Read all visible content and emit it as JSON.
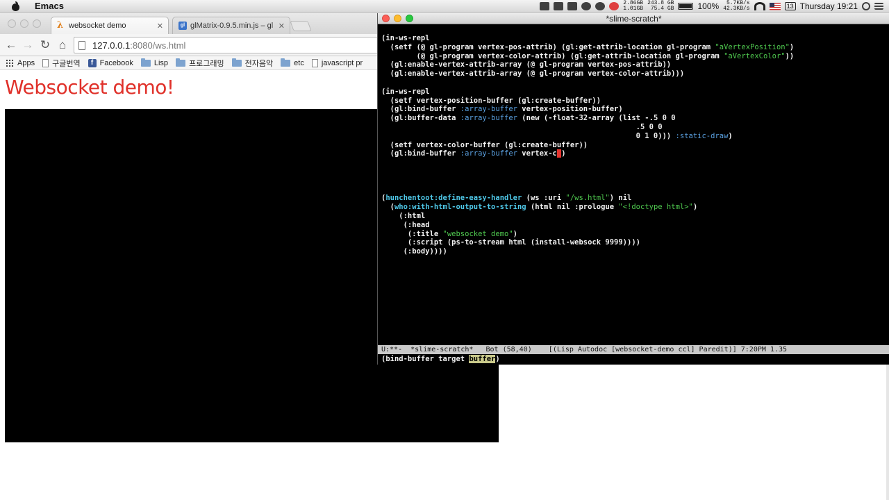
{
  "menubar": {
    "app_name": "Emacs",
    "mem_used": "2.86GB",
    "mem_free": "1.01GB",
    "disk_used": "243.8 GB",
    "disk_free": "75.4 GB",
    "battery": "100%",
    "net_up": "5.7KB/s",
    "net_down": "42.3KB/s",
    "calendar_day": "13",
    "clock": "Thursday 19:21"
  },
  "browser": {
    "tabs": [
      {
        "label": "websocket demo",
        "active": true
      },
      {
        "label": "glMatrix-0.9.5.min.js – gl",
        "active": false
      }
    ],
    "url_host": "127.0.0.1",
    "url_rest": ":8080/ws.html",
    "bookmarks": [
      "Apps",
      "구글번역",
      "Facebook",
      "Lisp",
      "프로그래밍",
      "전자음악",
      "etc",
      "javascript pr"
    ],
    "page_heading": "Websocket demo!"
  },
  "emacs": {
    "title": "*slime-scratch*",
    "code_lines": [
      [
        {
          "t": "(in-ws-repl"
        }
      ],
      [
        {
          "t": "  (setf (@ gl-program vertex-pos-attrib) (gl:get-attrib-location gl-program "
        },
        {
          "t": "\"aVertexPosition\"",
          "c": "str"
        },
        {
          "t": ")"
        }
      ],
      [
        {
          "t": "        (@ gl-program vertex-color-attrib) (gl:get-attrib-location gl-program "
        },
        {
          "t": "\"aVertexColor\"",
          "c": "str"
        },
        {
          "t": "))"
        }
      ],
      [
        {
          "t": "  (gl:enable-vertex-attrib-array (@ gl-program vertex-pos-attrib))"
        }
      ],
      [
        {
          "t": "  (gl:enable-vertex-attrib-array (@ gl-program vertex-color-attrib)))"
        }
      ],
      [
        {
          "t": ""
        }
      ],
      [
        {
          "t": "(in-ws-repl"
        }
      ],
      [
        {
          "t": "  (setf vertex-position-buffer (gl:create-buffer))"
        }
      ],
      [
        {
          "t": "  (gl:bind-buffer "
        },
        {
          "t": ":array-buffer",
          "c": "kw"
        },
        {
          "t": " vertex-position-buffer)"
        }
      ],
      [
        {
          "t": "  (gl:buffer-data "
        },
        {
          "t": ":array-buffer",
          "c": "kw"
        },
        {
          "t": " (new (-float-32-array (list -.5 0 0"
        }
      ],
      [
        {
          "t": "                                                          .5 0 0"
        }
      ],
      [
        {
          "t": "                                                          0 1 0))) "
        },
        {
          "t": ":static-draw",
          "c": "kw"
        },
        {
          "t": ")"
        }
      ],
      [
        {
          "t": "  (setf vertex-color-buffer (gl:create-buffer))"
        }
      ],
      [
        {
          "t": "  (gl:bind-buffer "
        },
        {
          "t": ":array-buffer",
          "c": "kw"
        },
        {
          "t": " vertex-c"
        },
        {
          "t": ")",
          "c": "cursor"
        },
        {
          "t": ")"
        }
      ],
      [
        {
          "t": ""
        }
      ],
      [
        {
          "t": ""
        }
      ],
      [
        {
          "t": ""
        }
      ],
      [
        {
          "t": ""
        }
      ],
      [
        {
          "t": "("
        },
        {
          "t": "hunchentoot:define-easy-handler",
          "c": "fn"
        },
        {
          "t": " (ws :uri "
        },
        {
          "t": "\"/ws.html\"",
          "c": "str"
        },
        {
          "t": ") nil"
        }
      ],
      [
        {
          "t": "  ("
        },
        {
          "t": "who:with-html-output-to-string",
          "c": "fn"
        },
        {
          "t": " (html nil :prologue "
        },
        {
          "t": "\"<!doctype html>\"",
          "c": "str"
        },
        {
          "t": ")"
        }
      ],
      [
        {
          "t": "    (:html"
        }
      ],
      [
        {
          "t": "     (:head"
        }
      ],
      [
        {
          "t": "      (:title "
        },
        {
          "t": "\"websocket demo\"",
          "c": "str"
        },
        {
          "t": ")"
        }
      ],
      [
        {
          "t": "      (:script (ps-to-stream html (install-websock 9999))))"
        }
      ],
      [
        {
          "t": "     (:body))))"
        }
      ]
    ],
    "modeline": "U:**-  *slime-scratch*   Bot (58,40)    [(Lisp Autodoc [websocket-demo ccl] Paredit)] 7:20PM 1.35",
    "minibuffer_prefix": "(bind-buffer target ",
    "minibuffer_highlight": "buffer",
    "minibuffer_suffix": ")"
  },
  "colors": {
    "heading": "#e0312a",
    "string": "#4fc94f",
    "keyword": "#5aa0e0",
    "function": "#4fc8e8",
    "cursor": "#e3342e"
  }
}
